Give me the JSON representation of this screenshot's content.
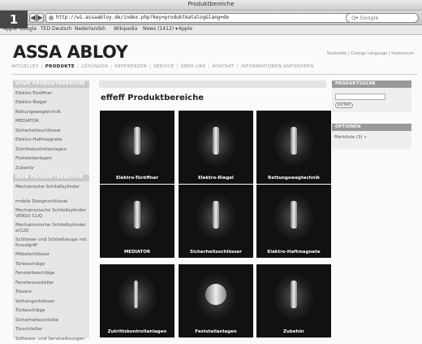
{
  "browser": {
    "window_title": "Produktbereiche",
    "url": "http://w1.assaabloy.de/index.php?key=produktkatalog&lang=de",
    "search_placeholder": "Q▾ Google",
    "reload_glyph": "C",
    "back_glyph": "◀",
    "forward_glyph": "▶",
    "add_glyph": "+",
    "bookmarks": [
      "Apple",
      "Google",
      "TED Deutsch",
      "Nederlandsh",
      "Wikipedia",
      "News (1412) ▾",
      "Apple"
    ]
  },
  "badge": {
    "number": "1",
    "color": "#d9201f"
  },
  "header": {
    "logo": "ASSA ABLOY",
    "top_links": "Startseite  |  Change Language  |  Impressum"
  },
  "main_nav": [
    {
      "label": "AKTUELLES",
      "active": false
    },
    {
      "label": "PRODUKTE",
      "active": true
    },
    {
      "label": "LÖSUNGEN",
      "active": false
    },
    {
      "label": "REFERENZEN",
      "active": false
    },
    {
      "label": "SERVICE",
      "active": false
    },
    {
      "label": "ÜBER UNS",
      "active": false
    },
    {
      "label": "KONTAKT",
      "active": false
    },
    {
      "label": "INFORMATIONEN ANFORDERN",
      "active": false
    }
  ],
  "sidebar": {
    "items": [
      {
        "label": "effeff PRODUKTBEREICHE",
        "head": true
      },
      {
        "label": "Elektro-Türöffner"
      },
      {
        "label": "Elektro-Riegel"
      },
      {
        "label": "Rettungswegtechnik"
      },
      {
        "label": "MEDIATOR"
      },
      {
        "label": "Sicherheitsschlösser"
      },
      {
        "label": "Elektro-Haftmagnete"
      },
      {
        "label": "Zutrittskontrollanlagen"
      },
      {
        "label": "Feststellanlagen"
      },
      {
        "label": "Zubehör"
      },
      {
        "label": "IKON PRODUKTBEREICHE",
        "head": true
      },
      {
        "label": "Mechanische Schließzylinder"
      },
      {
        "label": "mobile Designschlüssel"
      },
      {
        "label": "Mechatronische Schließzylinder VERSO CLIQ"
      },
      {
        "label": "Mechatronische Schließzylinder eCLIQ"
      },
      {
        "label": "Schlösser und Schließzeuge mit Knaufgriff"
      },
      {
        "label": "Möbelschlösser"
      },
      {
        "label": "Türbeschläge"
      },
      {
        "label": "Fensterbeschläge"
      },
      {
        "label": "Fensteraussteller"
      },
      {
        "label": "Tresore"
      },
      {
        "label": "Vorhangschlösser"
      },
      {
        "label": "Türbeschläge"
      },
      {
        "label": "Sicherheitsschließe"
      },
      {
        "label": "Türschließer"
      },
      {
        "label": "Software- und Servicelösungen"
      }
    ]
  },
  "content": {
    "title": "effeff Produktbereiche",
    "tiles": [
      "Elektro-Türöffner",
      "Elektro-Riegel",
      "Rettungswegtechnik",
      "MEDIATOR",
      "Sicherheitsschlösser",
      "Elektro-Haftmagnete",
      "Zutrittskontrollanlagen",
      "Feststellanlagen",
      "Zubehör"
    ]
  },
  "right": {
    "search_title": "PRODUKTSUCHE",
    "search_button": "suchen",
    "options_title": "OPTIONEN",
    "watchlist": "Merkliste (3) »"
  }
}
